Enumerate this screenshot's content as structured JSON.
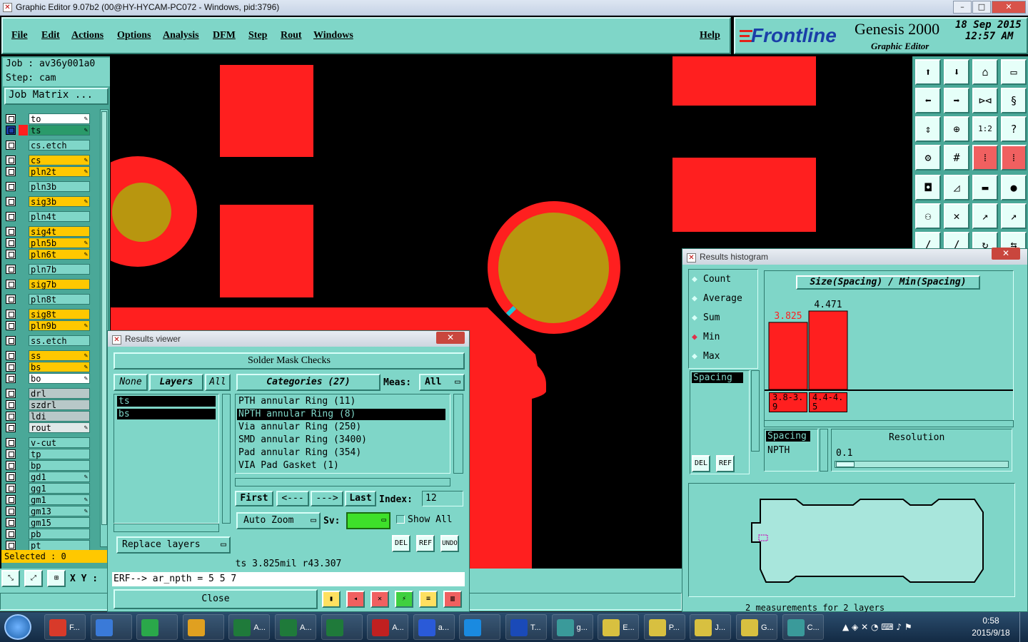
{
  "window": {
    "title": "Graphic Editor 9.07b2 (00@HY-HYCAM-PC072 - Windows, pid:3796)",
    "min": "–",
    "max": "□",
    "close": "✕"
  },
  "menu": {
    "items": [
      "File",
      "Edit",
      "Actions",
      "Options",
      "Analysis",
      "DFM",
      "Step",
      "Rout",
      "Windows"
    ],
    "help": "Help"
  },
  "brand": {
    "logo": "Frontline",
    "product": "Genesis 2000",
    "subtitle": "Graphic Editor",
    "date": "18 Sep 2015",
    "time": "12:57 AM"
  },
  "job": {
    "job_label": "Job : av36y001a0",
    "step_label": "Step: cam",
    "matrix_button": "Job Matrix ..."
  },
  "layers": [
    {
      "name": "to",
      "color": "#ffffff",
      "pen": true
    },
    {
      "name": "ts",
      "color": "#2a9a6a",
      "pen": true,
      "active": true
    },
    {
      "name": "cs.etch",
      "color": "#7fd6c8",
      "pen": false
    },
    {
      "name": "cs",
      "color": "#ffc800",
      "pen": true
    },
    {
      "name": "pln2t",
      "color": "#ffc800",
      "pen": true
    },
    {
      "name": "pln3b",
      "color": "#7fd6c8",
      "pen": false
    },
    {
      "name": "sig3b",
      "color": "#ffc800",
      "pen": true
    },
    {
      "name": "pln4t",
      "color": "#7fd6c8",
      "pen": false
    },
    {
      "name": "sig4t",
      "color": "#ffc800",
      "pen": false
    },
    {
      "name": "pln5b",
      "color": "#ffc800",
      "pen": true
    },
    {
      "name": "pln6t",
      "color": "#ffc800",
      "pen": true
    },
    {
      "name": "pln7b",
      "color": "#7fd6c8",
      "pen": false
    },
    {
      "name": "sig7b",
      "color": "#ffc800",
      "pen": false
    },
    {
      "name": "pln8t",
      "color": "#7fd6c8",
      "pen": false
    },
    {
      "name": "sig8t",
      "color": "#ffc800",
      "pen": false
    },
    {
      "name": "pln9b",
      "color": "#ffc800",
      "pen": true
    },
    {
      "name": "ss.etch",
      "color": "#7fd6c8",
      "pen": false
    },
    {
      "name": "ss",
      "color": "#ffc800",
      "pen": true
    },
    {
      "name": "bs",
      "color": "#ffc800",
      "pen": true
    },
    {
      "name": "bo",
      "color": "#ffffff",
      "pen": true
    },
    {
      "name": "drl",
      "color": "#b8c8c8",
      "pen": false
    },
    {
      "name": "szdrl",
      "color": "#b8c8c8",
      "pen": false
    },
    {
      "name": "ldi",
      "color": "#b8c8c8",
      "pen": false
    },
    {
      "name": "rout",
      "color": "#e0e8e8",
      "pen": true
    },
    {
      "name": "v-cut",
      "color": "#7fd6c8",
      "pen": false
    },
    {
      "name": "tp",
      "color": "#7fd6c8",
      "pen": false
    },
    {
      "name": "bp",
      "color": "#7fd6c8",
      "pen": false
    },
    {
      "name": "gd1",
      "color": "#7fd6c8",
      "pen": true
    },
    {
      "name": "gg1",
      "color": "#7fd6c8",
      "pen": false
    },
    {
      "name": "gm1",
      "color": "#7fd6c8",
      "pen": true
    },
    {
      "name": "gm13",
      "color": "#7fd6c8",
      "pen": true
    },
    {
      "name": "gm15",
      "color": "#7fd6c8",
      "pen": false
    },
    {
      "name": "pb",
      "color": "#7fd6c8",
      "pen": false
    },
    {
      "name": "pt",
      "color": "#7fd6c8",
      "pen": false
    }
  ],
  "selected": "Selected : 0",
  "coords": {
    "label": "X Y :"
  },
  "results_viewer": {
    "title": "Results viewer",
    "close": "✕",
    "header": "Solder Mask Checks",
    "none_btn": "None",
    "layers_btn": "Layers",
    "all_btn": "All",
    "layer_items": [
      "ts",
      "bs"
    ],
    "categories_label": "Categories (27)",
    "meas_label": "Meas:",
    "meas_value": "All",
    "categories": [
      "PTH annular Ring (11)",
      "NPTH annular Ring (8)",
      "Via annular Ring (250)",
      "SMD annular Ring (3400)",
      "Pad annular Ring (354)",
      "VIA Pad Gasket (1)"
    ],
    "first": "First",
    "prev": "<---",
    "next": "--->",
    "last": "Last",
    "index_label": "Index:",
    "index_value": "12",
    "auto_zoom": "Auto Zoom",
    "sv_label": "Sv:",
    "show_all": "Show All",
    "replace_layers": "Replace layers",
    "del": "DEL",
    "ref": "REF",
    "undo": "UNDO",
    "status": "ts 3.825mil   r43.307",
    "erf": "ERF--> ar_npth = 5 5 7",
    "close_btn": "Close"
  },
  "histogram": {
    "title": "Results histogram",
    "close": "✕",
    "options": [
      "Count",
      "Average",
      "Sum",
      "Min",
      "Max"
    ],
    "selected_option": "Min",
    "list_item": "Spacing",
    "del": "DEL",
    "ref": "REF",
    "chart_title": "Size(Spacing) / Min(Spacing)",
    "spacing_label": "Spacing",
    "npth_label": "NPTH",
    "resolution_label": "Resolution",
    "resolution_value": "0.1",
    "footer": "2 measurements for 2 layers"
  },
  "chart_data": {
    "type": "bar",
    "title": "Size(Spacing) / Min(Spacing)",
    "categories": [
      "3.8-3.9",
      "4.4-4.5"
    ],
    "values": [
      3.825,
      4.471
    ]
  },
  "taskbar": {
    "items": [
      "F...",
      "",
      "",
      "",
      "A...",
      "A...",
      "",
      "A...",
      "a...",
      "",
      "T...",
      "g...",
      "E...",
      "P...",
      "J...",
      "G...",
      "C..."
    ],
    "time": "0:58",
    "date": "2015/9/18"
  }
}
